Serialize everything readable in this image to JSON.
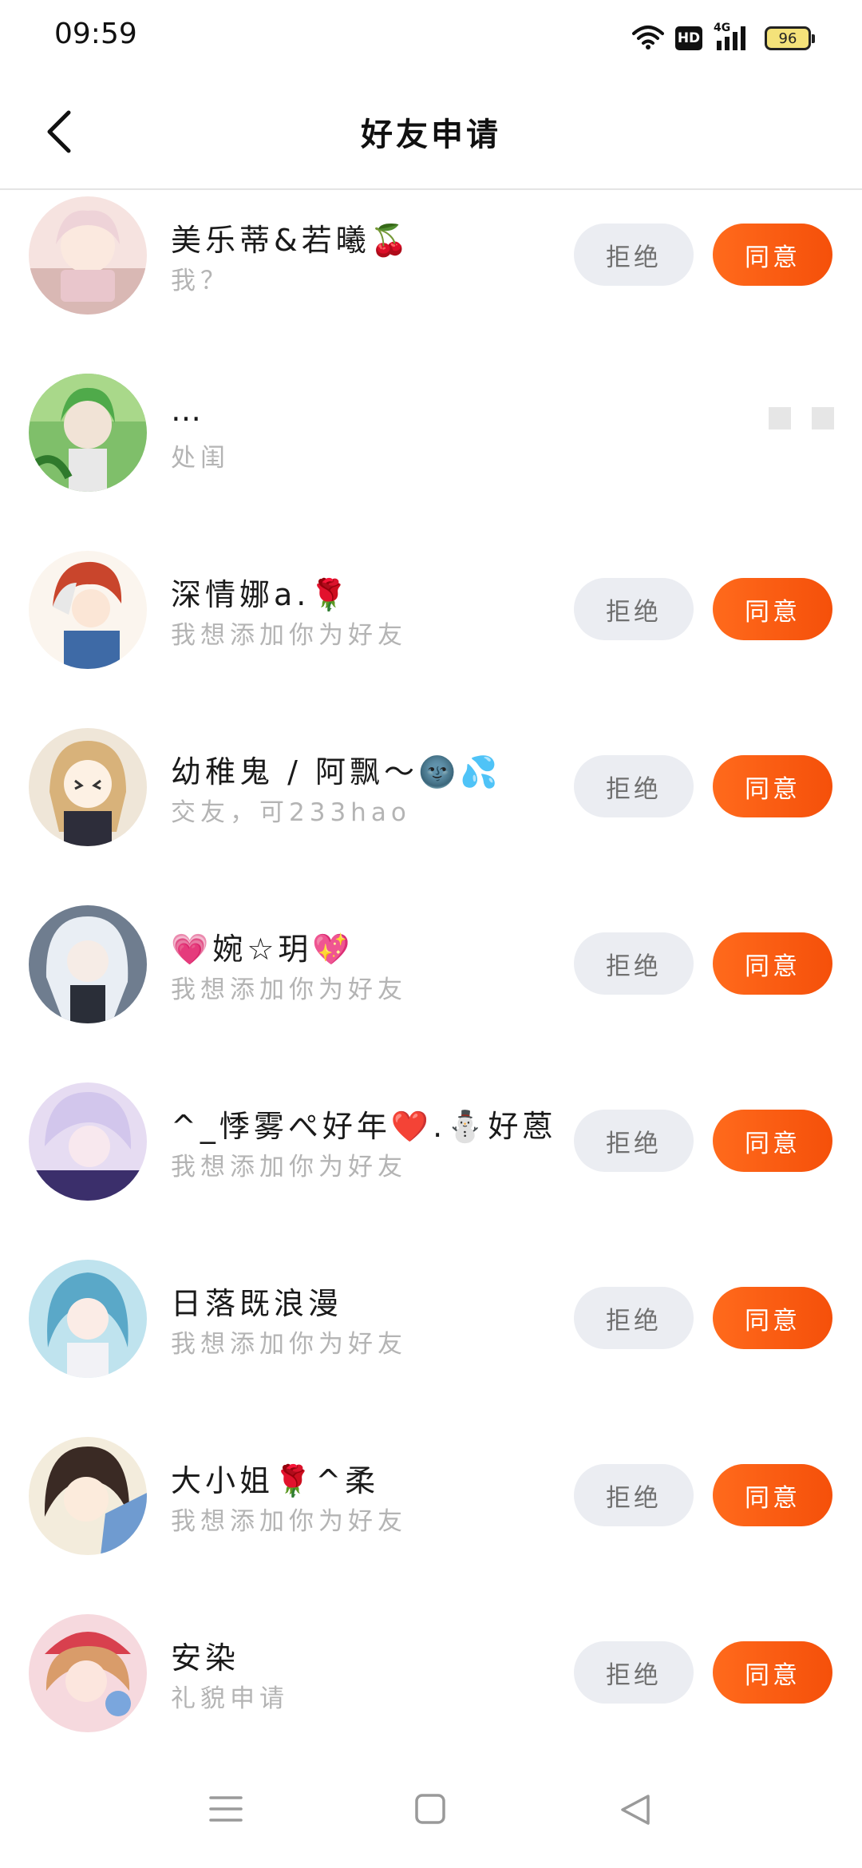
{
  "status_bar": {
    "time": "09:59",
    "hd_label": "HD",
    "network_label": "4G",
    "battery_level": "96"
  },
  "header": {
    "title": "好友申请"
  },
  "buttons": {
    "reject_label": "拒绝",
    "accept_label": "同意"
  },
  "requests": [
    {
      "name": "美乐蒂&若曦🍒",
      "message": "我？",
      "pending": true
    },
    {
      "name": "…",
      "message": "处闺",
      "pending": false
    },
    {
      "name": "深情娜a.🌹",
      "message": "我想添加你为好友",
      "pending": true
    },
    {
      "name": "幼稚鬼 / 阿飘～🌚💦",
      "message": "交友，可233hao",
      "pending": true
    },
    {
      "name": "💗婉☆玥💖",
      "message": "我想添加你为好友",
      "pending": true
    },
    {
      "name": "^_悸雾ぺ好年❤️.⛄好蒽",
      "message": "我想添加你为好友",
      "pending": true
    },
    {
      "name": "日落既浪漫",
      "message": "我想添加你为好友",
      "pending": true
    },
    {
      "name": "大小姐🌹^柔",
      "message": "我想添加你为好友",
      "pending": true
    },
    {
      "name": "安染",
      "message": "礼貌申请",
      "pending": true
    }
  ],
  "colors": {
    "accent": "#fa5a14",
    "reject_bg": "#ebedf2",
    "secondary_text": "#b4b4b4"
  },
  "icons": {
    "back": "chevron-left-icon",
    "wifi": "wifi-icon",
    "signal": "signal-icon",
    "battery": "battery-icon",
    "menu": "menu-icon",
    "home": "home-icon",
    "back_nav": "triangle-back-icon"
  }
}
